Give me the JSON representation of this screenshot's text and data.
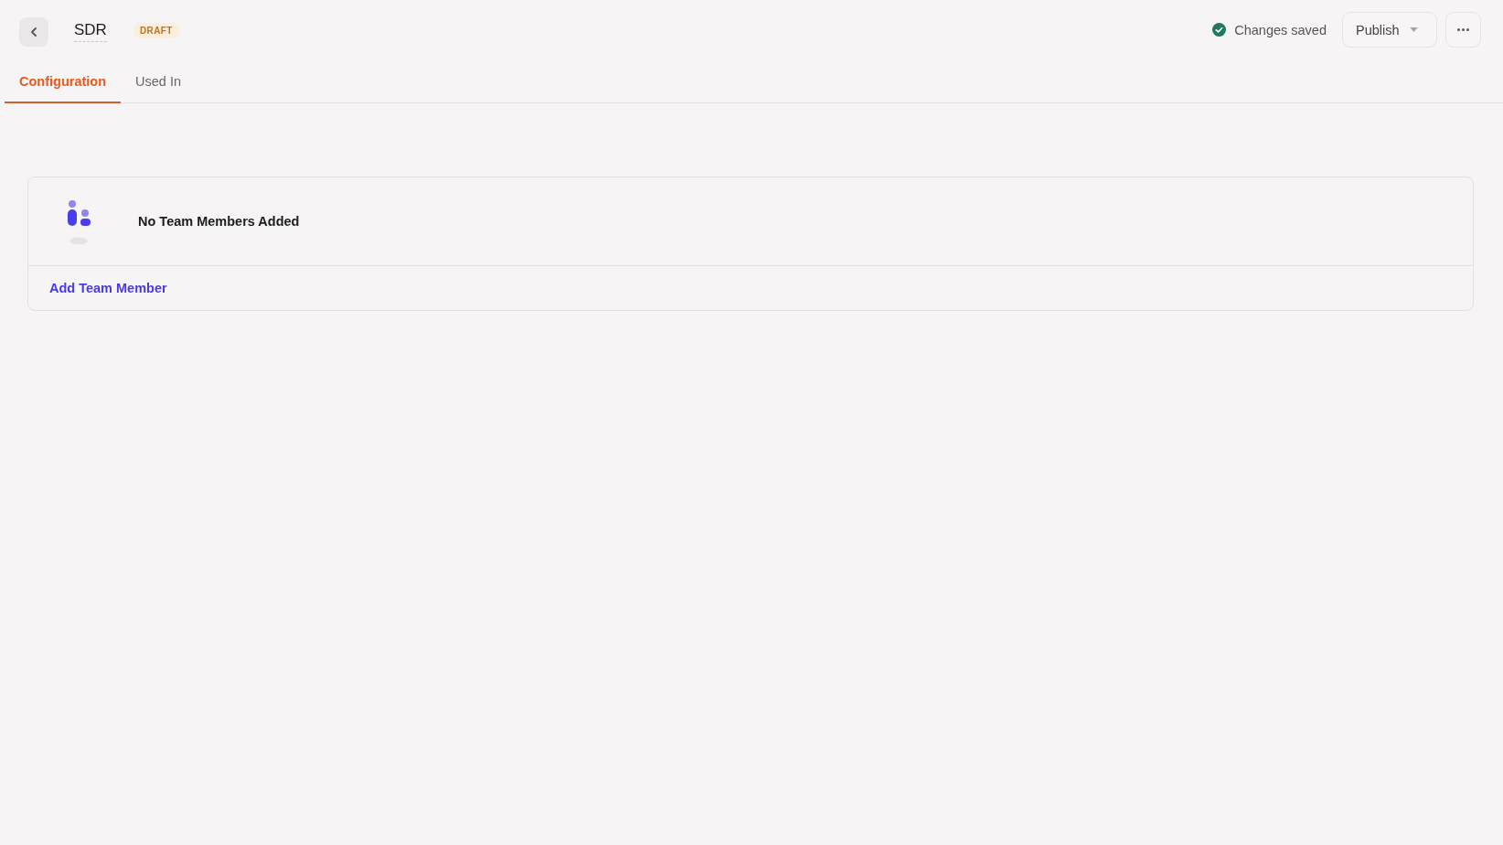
{
  "header": {
    "title": "SDR",
    "status_badge": "DRAFT",
    "save_status": "Changes saved",
    "publish_button": "Publish"
  },
  "tabs": [
    {
      "label": "Configuration",
      "selected": true
    },
    {
      "label": "Used In",
      "selected": false
    }
  ],
  "team_members_card": {
    "empty_title": "No Team Members Added",
    "add_link": "Add Team Member"
  }
}
